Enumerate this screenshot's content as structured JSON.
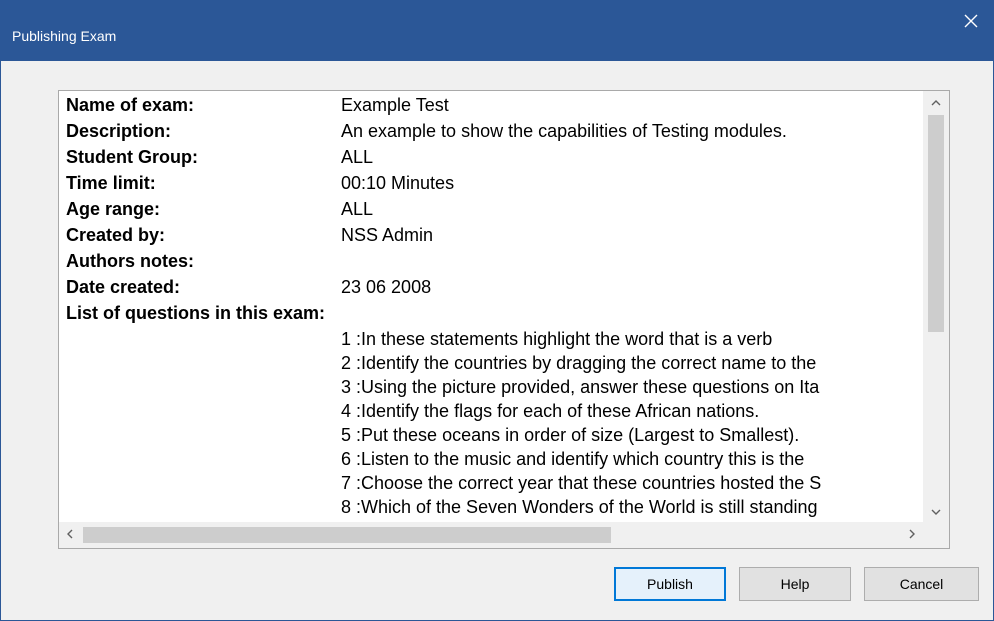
{
  "window": {
    "title": "Publishing Exam"
  },
  "details": [
    {
      "label": "Name of exam:",
      "value": "Example Test"
    },
    {
      "label": "Description:",
      "value": "An example to show the capabilities of Testing modules."
    },
    {
      "label": "Student Group:",
      "value": "ALL"
    },
    {
      "label": "Time limit:",
      "value": "00:10 Minutes"
    },
    {
      "label": "Age range:",
      "value": "ALL"
    },
    {
      "label": "Created by:",
      "value": "NSS Admin"
    },
    {
      "label": "Authors notes:",
      "value": ""
    },
    {
      "label": "Date created:",
      "value": "23 06 2008"
    }
  ],
  "questions_heading": "List of questions in this exam:",
  "questions": [
    "1 :In these statements highlight the word that is a verb",
    "2 :Identify the countries by dragging the correct name to the",
    "3 :Using the picture provided, answer these questions on Ita",
    "4 :Identify the flags for each of these African nations.",
    "5 :Put these oceans in order of size (Largest to Smallest).",
    "6 :Listen to the music and identify which country this is the",
    "7 :Choose the correct year that these countries hosted the S",
    "8 :Which of the Seven Wonders of the World is still standing"
  ],
  "buttons": {
    "publish": "Publish",
    "help": "Help",
    "cancel": "Cancel"
  },
  "icons": {
    "close": "close-icon",
    "scroll_up": "chevron-up-icon",
    "scroll_down": "chevron-down-icon",
    "scroll_left": "chevron-left-icon",
    "scroll_right": "chevron-right-icon"
  },
  "colors": {
    "titlebar": "#2b5797",
    "default_button_border": "#0078d7"
  }
}
